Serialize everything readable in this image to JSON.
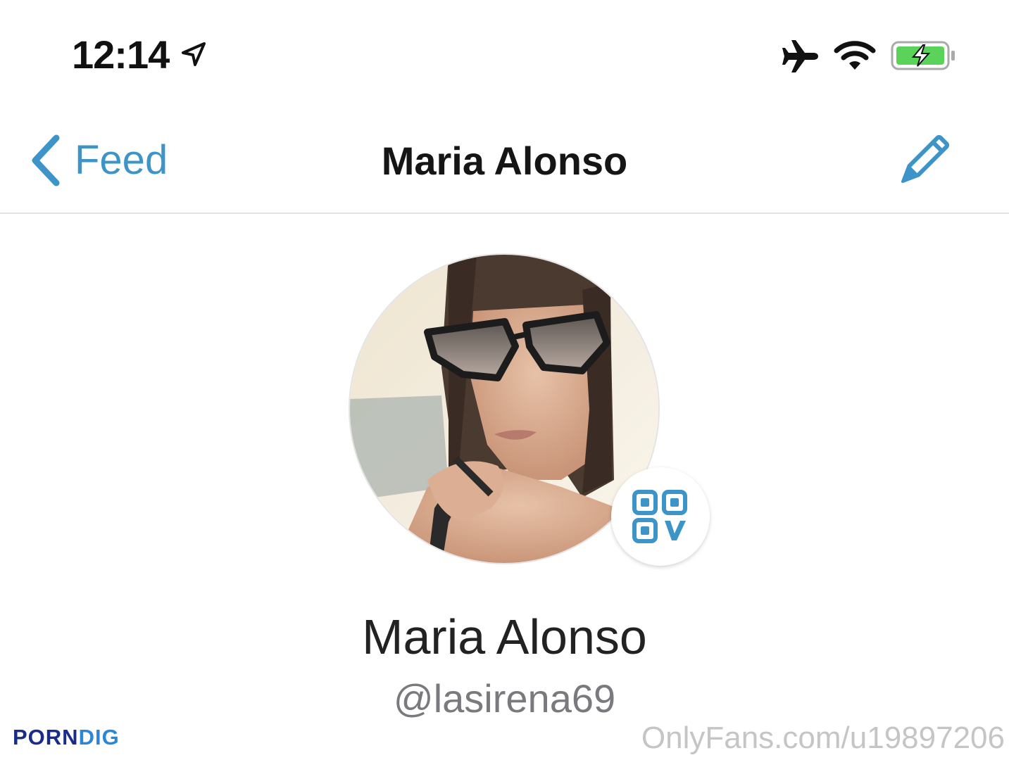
{
  "status_bar": {
    "time": "12:14",
    "icons": [
      "location-arrow-icon",
      "airplane-icon",
      "wifi-icon",
      "battery-charging-icon"
    ],
    "battery_color": "#5bd35b"
  },
  "nav": {
    "back_label": "Feed",
    "title": "Maria Alonso",
    "accent_color": "#3d94c9",
    "right_icon": "pencil-icon"
  },
  "profile": {
    "name": "Maria Alonso",
    "handle": "@lasirena69",
    "qr_icon": "qr-code-icon"
  },
  "watermarks": {
    "left_part1": "PORN",
    "left_part2": "DIG",
    "right": "OnlyFans.com/u19897206"
  }
}
